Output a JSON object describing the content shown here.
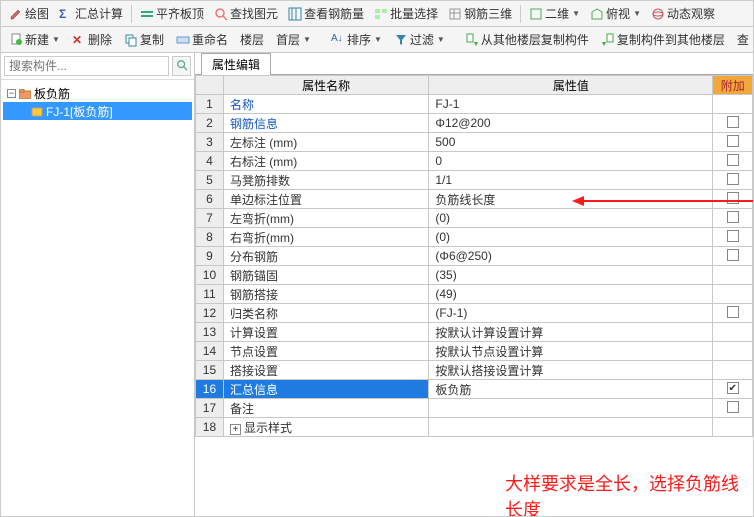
{
  "toolbar1": {
    "draw": "绘图",
    "sumcalc": "汇总计算",
    "flatten": "平齐板顶",
    "findelem": "查找图元",
    "viewrebar": "查看钢筋量",
    "batchsel": "批量选择",
    "rebar3d": "钢筋三维",
    "twod": "二维",
    "topview": "俯视",
    "dynview": "动态观察"
  },
  "toolbar2": {
    "newbtn": "新建",
    "delete": "删除",
    "copy": "复制",
    "rename": "重命名",
    "floor": "楼层",
    "first": "首层",
    "sort": "排序",
    "filter": "过滤",
    "copyfrom": "从其他楼层复制构件",
    "copyto": "复制构件到其他楼层",
    "find": "查"
  },
  "search": {
    "placeholder": "搜索构件..."
  },
  "tree": {
    "root": "板负筋",
    "child": "FJ-1[板负筋]"
  },
  "tab": "属性编辑",
  "headers": {
    "name": "属性名称",
    "value": "属性值",
    "attach": "附加"
  },
  "rows": [
    {
      "n": 1,
      "name": "名称",
      "nameBlue": true,
      "val": "FJ-1",
      "chk": null
    },
    {
      "n": 2,
      "name": "钢筋信息",
      "nameBlue": true,
      "val": "Φ12@200",
      "chk": false
    },
    {
      "n": 3,
      "name": "左标注 (mm)",
      "nameBlue": false,
      "val": "500",
      "chk": false
    },
    {
      "n": 4,
      "name": "右标注 (mm)",
      "nameBlue": false,
      "val": "0",
      "chk": false
    },
    {
      "n": 5,
      "name": "马凳筋排数",
      "nameBlue": false,
      "val": "1/1",
      "chk": false
    },
    {
      "n": 6,
      "name": "单边标注位置",
      "nameBlue": false,
      "val": "负筋线长度",
      "chk": false,
      "arrow": true
    },
    {
      "n": 7,
      "name": "左弯折(mm)",
      "nameBlue": false,
      "val": "(0)",
      "chk": false
    },
    {
      "n": 8,
      "name": "右弯折(mm)",
      "nameBlue": false,
      "val": "(0)",
      "chk": false
    },
    {
      "n": 9,
      "name": "分布钢筋",
      "nameBlue": false,
      "val": "(Φ6@250)",
      "chk": false
    },
    {
      "n": 10,
      "name": "钢筋锚固",
      "nameBlue": false,
      "val": "(35)",
      "chk": null
    },
    {
      "n": 11,
      "name": "钢筋搭接",
      "nameBlue": false,
      "val": "(49)",
      "chk": null
    },
    {
      "n": 12,
      "name": "归类名称",
      "nameBlue": false,
      "val": "(FJ-1)",
      "chk": false
    },
    {
      "n": 13,
      "name": "计算设置",
      "nameBlue": false,
      "val": "按默认计算设置计算",
      "chk": null
    },
    {
      "n": 14,
      "name": "节点设置",
      "nameBlue": false,
      "val": "按默认节点设置计算",
      "chk": null
    },
    {
      "n": 15,
      "name": "搭接设置",
      "nameBlue": false,
      "val": "按默认搭接设置计算",
      "chk": null
    },
    {
      "n": 16,
      "name": "汇总信息",
      "nameBlue": false,
      "val": "板负筋",
      "chk": true,
      "hl": true
    },
    {
      "n": 17,
      "name": "备注",
      "nameBlue": false,
      "val": "",
      "chk": false
    },
    {
      "n": 18,
      "name": "显示样式",
      "nameBlue": false,
      "val": "",
      "chk": null,
      "expand": true
    }
  ],
  "annotation": "大样要求是全长，选择负筋线长度"
}
